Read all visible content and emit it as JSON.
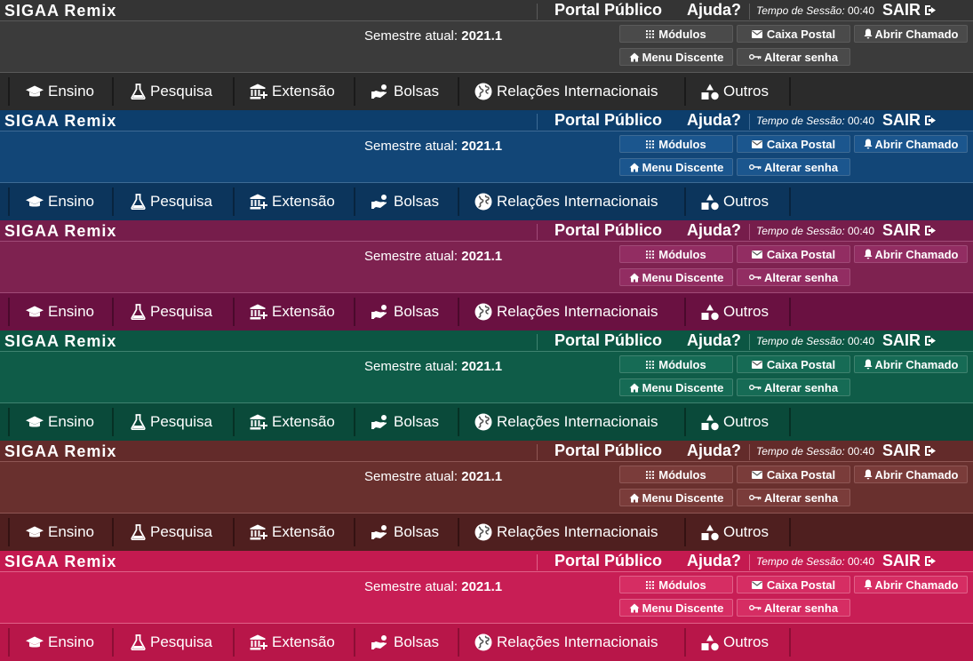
{
  "header": {
    "brand": "SIGAA Remix",
    "portal_label": "Portal Público",
    "help_label": "Ajuda?",
    "session_label": "Tempo de Sessão:",
    "session_time": "00:40",
    "logout_label": "SAIR"
  },
  "semester": {
    "label": "Semestre atual:",
    "value": "2021.1"
  },
  "buttons": {
    "modulos": "Módulos",
    "caixa": "Caixa Postal",
    "chamado": "Abrir Chamado",
    "menu": "Menu Discente",
    "senha": "Alterar senha"
  },
  "nav": {
    "ensino": "Ensino",
    "pesquisa": "Pesquisa",
    "extensao": "Extensão",
    "bolsas": "Bolsas",
    "relacoes": "Relações Internacionais",
    "outros": "Outros"
  },
  "icons": {
    "modulos": "grid-icon",
    "caixa": "envelope-icon",
    "chamado": "bell-icon",
    "menu": "home-icon",
    "senha": "key-icon",
    "sair": "sign-out-icon",
    "ensino": "graduation-cap-icon",
    "pesquisa": "flask-icon",
    "extensao": "institution-icon",
    "bolsas": "hand-coins-icon",
    "relacoes": "globe-icon",
    "outros": "shapes-icon"
  },
  "themes": [
    {
      "name": "gray",
      "top": "#343434",
      "mid": "#3b3b3b",
      "nav": "#2b2b2b",
      "line": "#5a5a5a",
      "btn": "#4a4a4a",
      "nsep": "#1a1a1a"
    },
    {
      "name": "blue",
      "top": "#0d3e6c",
      "mid": "#124677",
      "nav": "#0c355c",
      "line": "#3d6a94",
      "btn": "#1b568e",
      "nsep": "#08243f"
    },
    {
      "name": "purple",
      "top": "#761d4b",
      "mid": "#7e2250",
      "nav": "#6a1141",
      "line": "#a04a77",
      "btn": "#922d62",
      "nsep": "#4a0a2c"
    },
    {
      "name": "green",
      "top": "#0c5643",
      "mid": "#0f5c48",
      "nav": "#0a4a3a",
      "line": "#3f826f",
      "btn": "#166b55",
      "nsep": "#063125"
    },
    {
      "name": "brown",
      "top": "#632b2a",
      "mid": "#69302e",
      "nav": "#4f1f1f",
      "line": "#8e5654",
      "btn": "#7a3c3a",
      "nsep": "#341212"
    },
    {
      "name": "crimson",
      "top": "#c41a50",
      "mid": "#c81e55",
      "nav": "#b81649",
      "line": "#e06088",
      "btn": "#d62d63",
      "nsep": "#8d0e35"
    }
  ]
}
